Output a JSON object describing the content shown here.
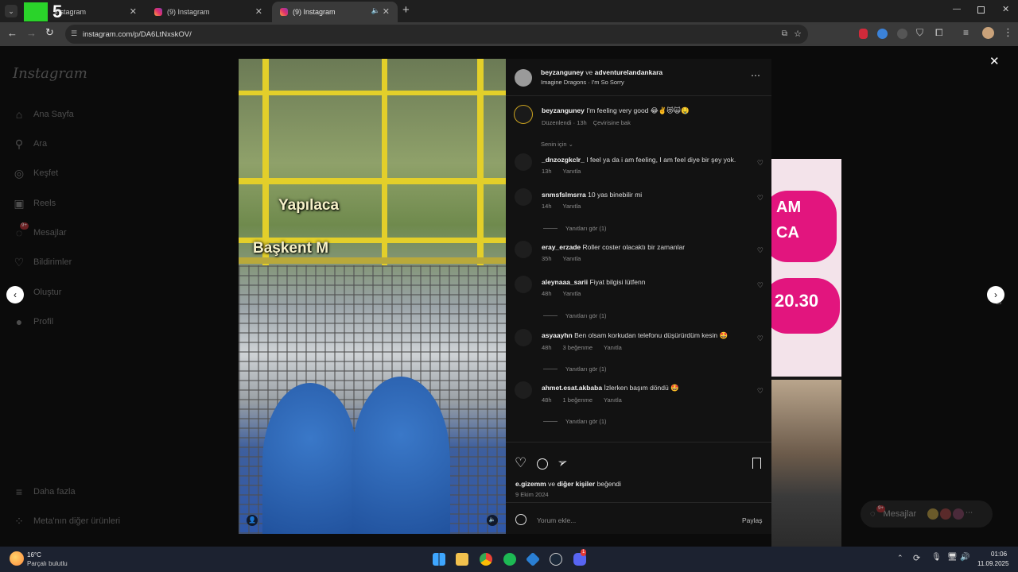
{
  "browser": {
    "tabs": [
      {
        "title": "Instagram",
        "active": false
      },
      {
        "title": "(9) Instagram",
        "active": false
      },
      {
        "title": "(9) Instagram",
        "active": true
      }
    ],
    "url": "instagram.com/p/DA6LtNxskOV/",
    "watermark": "5"
  },
  "sidebar": {
    "logo": "Instagram",
    "items": [
      {
        "label": "Ana Sayfa",
        "icon": "home-icon"
      },
      {
        "label": "Ara",
        "icon": "search-icon"
      },
      {
        "label": "Keşfet",
        "icon": "compass-icon"
      },
      {
        "label": "Reels",
        "icon": "reels-icon"
      },
      {
        "label": "Mesajlar",
        "icon": "messenger-icon",
        "badge": "9+"
      },
      {
        "label": "Bildirimler",
        "icon": "heart-icon"
      },
      {
        "label": "Oluştur",
        "icon": "plus-icon"
      },
      {
        "label": "Profil",
        "icon": "avatar-icon"
      }
    ],
    "more": "Daha fazla",
    "meta": "Meta'nın diğer ürünleri"
  },
  "post": {
    "video_text": [
      "Yapılaca",
      "Başkent M"
    ],
    "header": {
      "author": "beyzanguney",
      "and": "ve",
      "coauthor": "adventurelandankara",
      "audio": "Imagine Dragons · I'm So Sorry"
    },
    "caption": {
      "user": "beyzanguney",
      "text": "I'm feeling very good 😂✌️😻🙀🤤",
      "edited": "Düzenlendi · 13h",
      "translate": "Çevirisine bak"
    },
    "filter": "Senin için",
    "comments": [
      {
        "user": "_dnzozgkclr_",
        "text": "I feel ya da i am feeling, I am feel diye bir şey yok.",
        "time": "13h",
        "likes": "",
        "reply": "Yanıtla",
        "view_replies": ""
      },
      {
        "user": "snmsfslmsrra",
        "text": "10 yas binebilir mi",
        "time": "14h",
        "likes": "",
        "reply": "Yanıtla",
        "view_replies": "Yanıtları gör (1)"
      },
      {
        "user": "eray_erzade",
        "text": "Roller coster olacaktı bir zamanlar",
        "time": "35h",
        "likes": "",
        "reply": "Yanıtla",
        "view_replies": ""
      },
      {
        "user": "aleynaaa_sarii",
        "text": "Fiyat bilgisi lütfenn",
        "time": "48h",
        "likes": "",
        "reply": "Yanıtla",
        "view_replies": "Yanıtları gör (1)"
      },
      {
        "user": "asyaayhn",
        "text": "Ben olsam korkudan telefonu düşürürdüm kesin 🤩",
        "time": "48h",
        "likes": "3 beğenme",
        "reply": "Yanıtla",
        "view_replies": "Yanıtları gör (1)"
      },
      {
        "user": "ahmet.esat.akbaba",
        "text": "İzlerken başım döndü 🤩",
        "time": "48h",
        "likes": "1 beğenme",
        "reply": "Yanıtla",
        "view_replies": "Yanıtları gör (1)"
      }
    ],
    "likes": {
      "user": "e.gizemm",
      "and": "ve",
      "others": "diğer kişiler",
      "liked": "beğendi"
    },
    "date": "9 Ekim 2024",
    "comment_placeholder": "Yorum ekle...",
    "share": "Paylaş"
  },
  "preview": {
    "text": [
      "AM",
      "CA",
      "20.30"
    ]
  },
  "floating_messages": {
    "label": "Mesajlar",
    "badge": "9+"
  },
  "taskbar": {
    "weather_temp": "16°C",
    "weather_desc": "Parçalı bulutlu",
    "time": "01:06",
    "date": "11.09.2025",
    "badge": "1"
  },
  "colors": {
    "accent": "#e3cf2a",
    "instagram_pink": "#e1306c",
    "panel_bg": "#121212"
  }
}
